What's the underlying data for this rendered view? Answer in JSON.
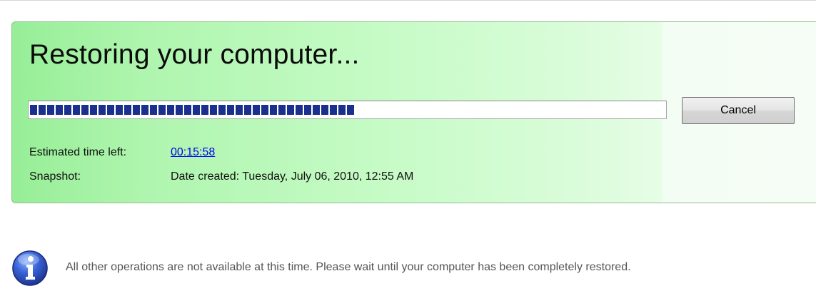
{
  "panel": {
    "title": "Restoring your computer...",
    "progress": {
      "value": 0.5
    },
    "cancel_label": "Cancel",
    "estimated_time": {
      "label": "Estimated time left:",
      "value": "00:15:58"
    },
    "snapshot": {
      "label": "Snapshot:",
      "value": "Date created: Tuesday, July 06, 2010, 12:55 AM"
    }
  },
  "notice": {
    "icon": "info-icon",
    "text": "All other operations are not available at this time. Please wait until your computer has been completely restored."
  },
  "colors": {
    "panel_green": "#aef5ae",
    "progress_blue": "#1b2f8f",
    "link_blue": "#0000ee"
  }
}
